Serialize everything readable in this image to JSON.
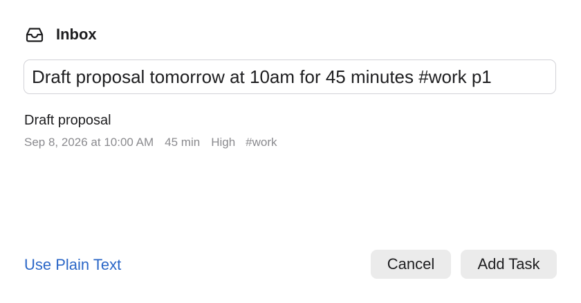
{
  "header": {
    "icon": "inbox-tray-icon",
    "title": "Inbox"
  },
  "input": {
    "value": "Draft proposal tomorrow at 10am for 45 minutes #work p1"
  },
  "preview": {
    "title": "Draft proposal",
    "date": "Sep 8, 2026 at 10:00 AM",
    "duration": "45 min",
    "priority": "High",
    "tag": "#work"
  },
  "footer": {
    "plain_text_label": "Use Plain Text",
    "cancel_label": "Cancel",
    "add_label": "Add Task"
  },
  "colors": {
    "link": "#2a66c7",
    "button_bg": "#ebebeb",
    "meta_text": "#8a8a8e"
  }
}
